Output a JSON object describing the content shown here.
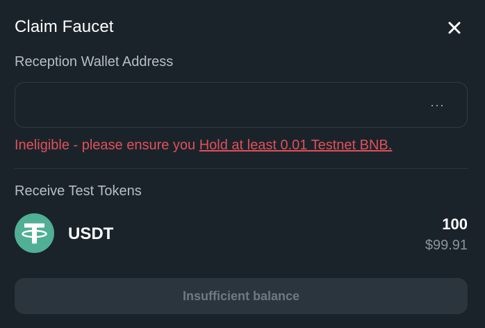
{
  "dialog": {
    "title": "Claim Faucet",
    "close_icon": "close-icon"
  },
  "wallet": {
    "label": "Reception Wallet Address",
    "value": "",
    "more_icon": "ellipsis-icon",
    "more_text": "···"
  },
  "eligibility": {
    "prefix": "Ineligible - please ensure you ",
    "link_text": "Hold at least 0.01 Testnet BNB.",
    "color": "#e0505b"
  },
  "receive": {
    "label": "Receive Test Tokens",
    "token": {
      "icon": "tether-icon",
      "symbol": "USDT",
      "amount": "100",
      "usd_value": "$99.91",
      "brand_color": "#50af95"
    }
  },
  "submit": {
    "label": "Insufficient balance",
    "disabled": true
  }
}
